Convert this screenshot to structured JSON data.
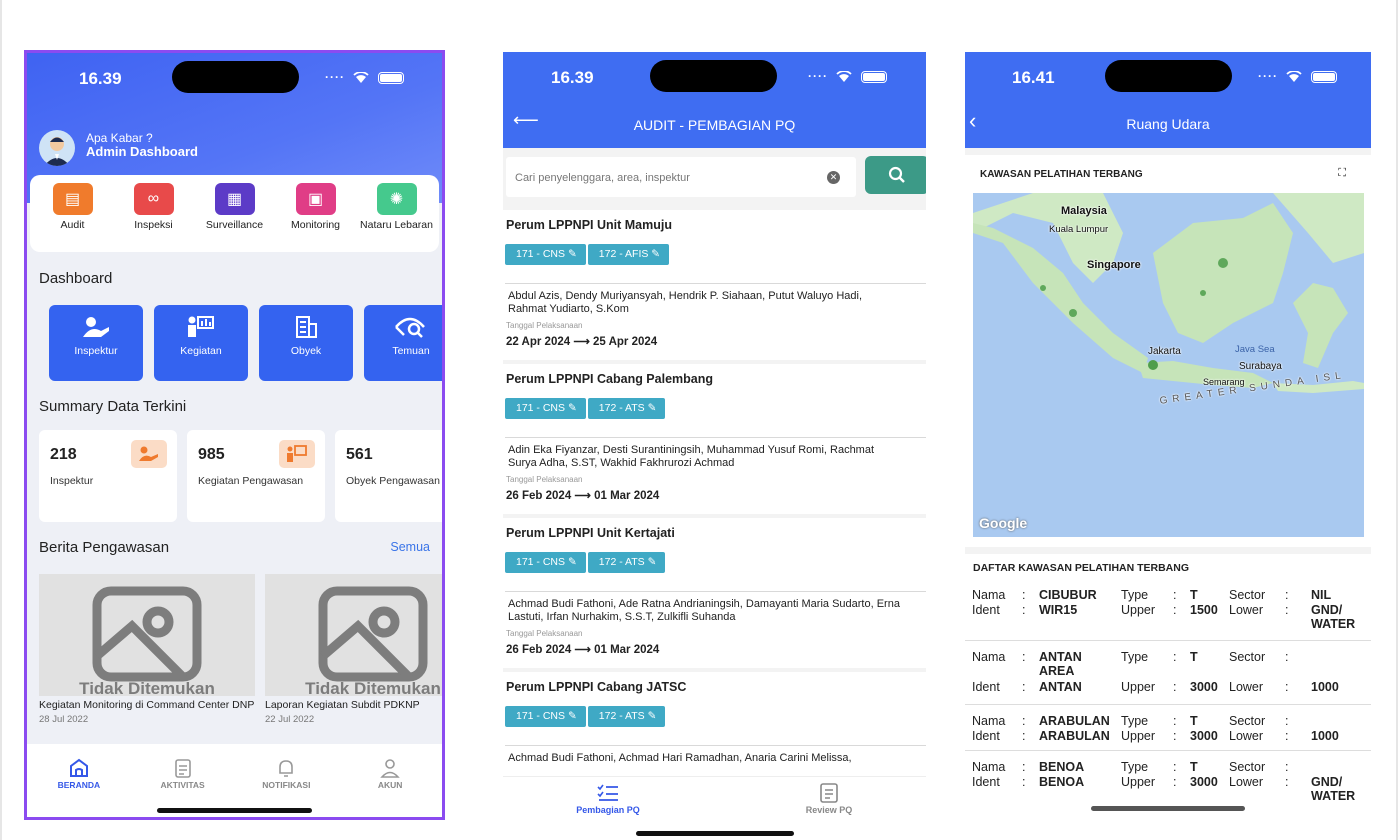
{
  "phone1": {
    "time": "16.39",
    "greeting": "Apa Kabar ?",
    "user": "Admin Dashboard",
    "menu": [
      {
        "label": "Audit",
        "icon": "audit-icon",
        "color": "#f07b2c"
      },
      {
        "label": "Inspeksi",
        "icon": "binoculars-icon",
        "color": "#e84a4a"
      },
      {
        "label": "Surveillance",
        "icon": "building-icon",
        "color": "#5c3bc7"
      },
      {
        "label": "Monitoring",
        "icon": "monitor-icon",
        "color": "#e03d86"
      },
      {
        "label": "Nataru Lebaran",
        "icon": "firework-icon",
        "color": "#45c98d"
      }
    ],
    "dashboard_title": "Dashboard",
    "dashboard": [
      "Inspektur",
      "Kegiatan",
      "Obyek",
      "Temuan"
    ],
    "summary_title": "Summary Data Terkini",
    "summary": [
      {
        "value": "218",
        "label": "Inspektur"
      },
      {
        "value": "985",
        "label": "Kegiatan Pengawasan"
      },
      {
        "value": "561",
        "label": "Obyek Pengawasan"
      }
    ],
    "news_title": "Berita Pengawasan",
    "news_more": "Semua",
    "news": [
      {
        "placeholder": "Tidak Ditemukan",
        "title": "Kegiatan Monitoring di Command Center DNP",
        "date": "28 Jul 2022"
      },
      {
        "placeholder": "Tidak Ditemukan",
        "title": "Laporan Kegiatan Subdit PDKNP",
        "date": "22 Jul 2022"
      }
    ],
    "nav": [
      "BERANDA",
      "AKTIVITAS",
      "NOTIFIKASI",
      "AKUN"
    ]
  },
  "phone2": {
    "time": "16.39",
    "title": "AUDIT - PEMBAGIAN PQ",
    "search_placeholder": "Cari penyelenggara, area, inspektur",
    "date_label": "Tanggal Pelaksanaan",
    "entries": [
      {
        "name": "Perum LPPNPI Unit Mamuju",
        "tags": [
          "171 - CNS",
          "172 - AFIS"
        ],
        "people": "Abdul Azis,  Dendy Muriyansyah,  Hendrik P. Siahaan,  Putut Waluyo Hadi,  Rahmat Yudiarto, S.Kom",
        "dates": "22 Apr 2024 ⟶ 25 Apr 2024"
      },
      {
        "name": "Perum LPPNPI Cabang Palembang",
        "tags": [
          "171 - CNS",
          "172 - ATS"
        ],
        "people": "Adin Eka Fiyanzar,  Desti Surantiningsih,  Muhammad Yusuf Romi,  Rachmat Surya Adha, S.ST,  Wakhid Fakhrurozi Achmad",
        "dates": "26 Feb 2024 ⟶ 01 Mar 2024"
      },
      {
        "name": "Perum LPPNPI Unit Kertajati",
        "tags": [
          "171 - CNS",
          "172 - ATS"
        ],
        "people": "Achmad Budi Fathoni,  Ade Ratna Andrianingsih,  Damayanti Maria Sudarto,  Erna Lastuti,  Irfan Nurhakim, S.S.T,  Zulkifli Suhanda",
        "dates": "26 Feb 2024 ⟶ 01 Mar 2024"
      },
      {
        "name": "Perum LPPNPI Cabang JATSC",
        "tags": [
          "171 - CNS",
          "172 - ATS"
        ],
        "people": "Achmad Budi Fathoni,  Achmad Hari Ramadhan,  Anaria Carini Melissa,",
        "dates": ""
      }
    ],
    "tabs": [
      "Pembagian PQ",
      "Review PQ"
    ]
  },
  "phone3": {
    "time": "16.41",
    "title": "Ruang Udara",
    "map_title": "KAWASAN PELATIHAN TERBANG",
    "map_labels": [
      "Malaysia",
      "Kuala Lumpur",
      "Singapore",
      "Jakarta",
      "Java Sea",
      "Surabaya",
      "Semarang",
      "GREATER SUNDA ISL"
    ],
    "map_brand": "Google",
    "list_title": "DAFTAR KAWASAN PELATIHAN TERBANG",
    "k": {
      "nama": "Nama",
      "ident": "Ident",
      "type": "Type",
      "upper": "Upper",
      "sector": "Sector",
      "lower": "Lower",
      "sep": ":"
    },
    "rows": [
      {
        "nama": "CIBUBUR",
        "ident": "WIR15",
        "type": "T",
        "upper": "1500",
        "sector": "NIL",
        "lower": "GND/ WATER"
      },
      {
        "nama": "ANTAN AREA",
        "ident": "ANTAN",
        "type": "T",
        "upper": "3000",
        "sector": "",
        "lower": "1000"
      },
      {
        "nama": "ARABULAN",
        "ident": "ARABULAN",
        "type": "T",
        "upper": "3000",
        "sector": "",
        "lower": "1000"
      },
      {
        "nama": "BENOA",
        "ident": "BENOA",
        "type": "T",
        "upper": "3000",
        "sector": "",
        "lower": "GND/ WATER"
      }
    ]
  },
  "colors": {
    "primary": "#3f6df2",
    "frame": "#8b4bf0",
    "tag": "#3fa9c5",
    "search": "#3c9a87"
  }
}
